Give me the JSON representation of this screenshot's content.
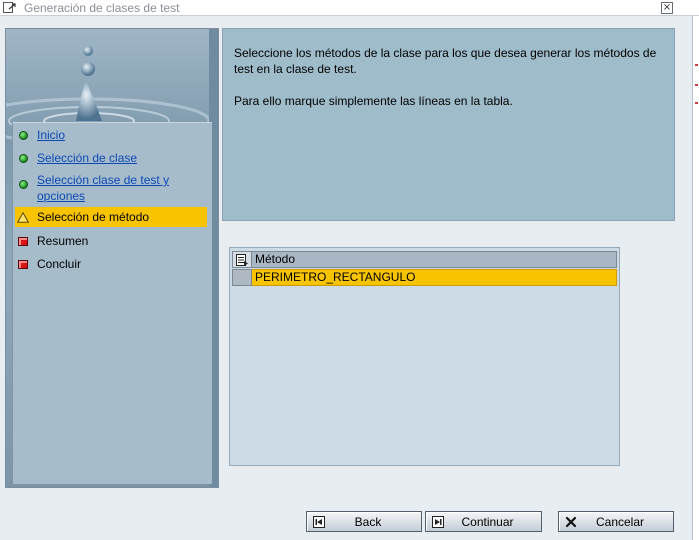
{
  "window": {
    "title": "Generación de clases de test",
    "close_label": "×"
  },
  "nav": {
    "items": [
      {
        "label": "Inicio",
        "status": "done",
        "link": true
      },
      {
        "label": "Selección de clase",
        "status": "done",
        "link": true
      },
      {
        "label": "Selección clase de test y opciones",
        "status": "done",
        "link": true
      },
      {
        "label": "Selección de método",
        "status": "current",
        "link": false
      },
      {
        "label": "Resumen",
        "status": "pending",
        "link": false
      },
      {
        "label": "Concluir",
        "status": "pending",
        "link": false
      }
    ]
  },
  "info": {
    "paragraph1": "Seleccione los métodos de la clase para los que desea generar los métodos de test en la clase de test.",
    "paragraph2": "Para ello marque simplemente las líneas en la tabla."
  },
  "table": {
    "column": "Método",
    "rows": [
      "PERIMETRO_RECTANGULO"
    ]
  },
  "buttons": {
    "back": "Back",
    "continue": "Continuar",
    "cancel": "Cancelar"
  },
  "colors": {
    "highlight": "#f8c400",
    "link": "#0b49b6",
    "panel": "#9fbccb"
  },
  "icons": {
    "done": "green-circle-icon",
    "current": "yellow-triangle-icon",
    "pending": "red-square-icon"
  }
}
